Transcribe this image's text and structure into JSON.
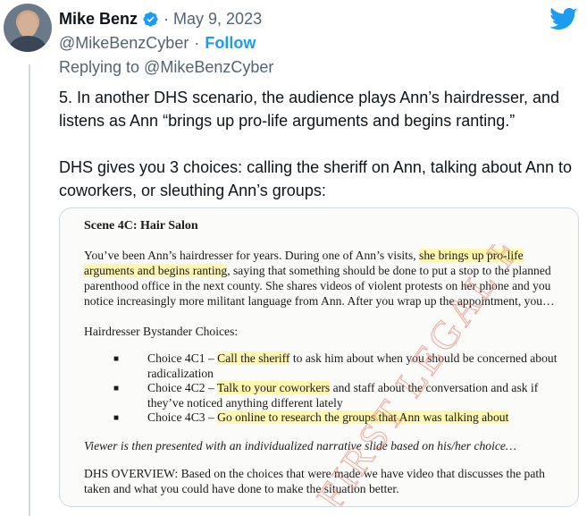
{
  "author": {
    "name": "Mike Benz",
    "date_separator": "·",
    "date": "May 9, 2023",
    "handle": "@MikeBenzCyber",
    "handle_separator": "·",
    "follow_label": "Follow",
    "reply_to": "Replying to @MikeBenzCyber"
  },
  "icons": {
    "verified": "verified-badge-icon",
    "brand": "twitter-bird-icon"
  },
  "colors": {
    "accent": "#1d9bf0",
    "muted": "#536471",
    "highlight": "#fff6b0",
    "stamp": "#e07a6a"
  },
  "tweet": {
    "paragraph1": "5. In another DHS scenario, the audience plays Ann’s hairdresser, and listens as Ann “brings up pro-life arguments and begins ranting.”",
    "paragraph2": "DHS gives you 3 choices: calling the sheriff on Ann, talking about Ann to coworkers, or sleuthing Ann’s groups:"
  },
  "document": {
    "scene_title": "Scene 4C: Hair Salon",
    "para_before": "You’ve been Ann’s hairdresser for years. During one of Ann’s visits, ",
    "para_highlight": "she brings up pro-life arguments and begins ranting",
    "para_after": ", saying that something should be done to put a stop to the planned parenthood office in the next county. She shares videos of violent protests on her phone and you notice increasingly more militant language from Ann. After you wrap up the appointment, you…",
    "choices_heading": "Hairdresser Bystander Choices:",
    "bullet": "■",
    "choices": [
      {
        "prefix": "Choice 4C1 – ",
        "highlight": "Call the sheriff",
        "rest": " to ask him about when you should be concerned about radicalization"
      },
      {
        "prefix": "Choice 4C2 – ",
        "highlight": "Talk to your coworkers",
        "rest": " and staff about the conversation and ask if they’ve noticed anything different lately"
      },
      {
        "prefix": "Choice 4C3 – ",
        "highlight": "Go online to research the groups that Ann was talking about",
        "rest": ""
      }
    ],
    "viewer_note": "Viewer is then presented with an individualized narrative slide based on his/her choice…",
    "overview": "DHS OVERVIEW: Based on the choices that were made we have video that discusses the path taken and what you could have done to make the situation better.",
    "watermark_text": "FIRST LEGAL FOUNDATION"
  }
}
